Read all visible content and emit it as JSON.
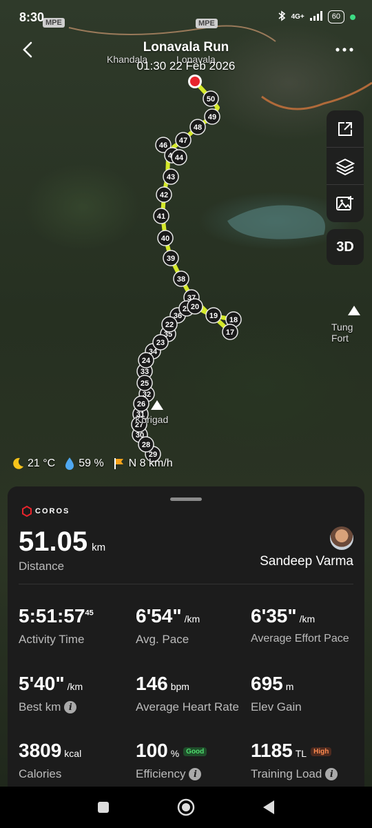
{
  "status_bar": {
    "time": "8:30",
    "network": "4G+",
    "battery": "60"
  },
  "header": {
    "title": "Lonavala Run",
    "subtitle": "01:30 22 Feb 2026"
  },
  "map": {
    "place_labels": [
      "Khandala",
      "Lonavala",
      "Tung Fort",
      "Korigad"
    ],
    "road_labels": [
      "MPE",
      "MPE"
    ],
    "km_markers": [
      "50",
      "49",
      "48",
      "47",
      "46",
      "45",
      "44",
      "43",
      "42",
      "41",
      "40",
      "39",
      "38",
      "37",
      "36",
      "35",
      "34",
      "33",
      "32",
      "31",
      "30",
      "29",
      "28",
      "27",
      "26",
      "25",
      "24",
      "23",
      "22",
      "21",
      "20",
      "19",
      "18",
      "17"
    ],
    "toolbar": [
      "share-icon",
      "layers-icon",
      "add-photo-icon"
    ],
    "three_d_label": "3D"
  },
  "weather": {
    "temperature": "21 °C",
    "humidity": "59 %",
    "wind": "N 8 km/h"
  },
  "panel": {
    "brand": "COROS",
    "distance_value": "51.05",
    "distance_unit": "km",
    "distance_label": "Distance",
    "user_name": "Sandeep Varma",
    "stats": [
      {
        "value": "5:51:57",
        "sup": "45",
        "unit": "",
        "label": "Activity Time"
      },
      {
        "value": "6'54\"",
        "unit": "/km",
        "label": "Avg. Pace"
      },
      {
        "value": "6'35\"",
        "unit": "/km",
        "label": "Average Effort Pace"
      },
      {
        "value": "5'40\"",
        "unit": "/km",
        "label": "Best km"
      },
      {
        "value": "146",
        "unit": "bpm",
        "label": "Average Heart Rate"
      },
      {
        "value": "695",
        "unit": "m",
        "label": "Elev Gain"
      },
      {
        "value": "3809",
        "unit": "kcal",
        "label": "Calories"
      },
      {
        "value": "100",
        "unit": "%",
        "badge": "Good",
        "label": "Efficiency"
      },
      {
        "value": "1185",
        "unit": "TL",
        "badge": "High",
        "label": "Training Load"
      }
    ]
  },
  "colors": {
    "route": "#d4e82a",
    "panel_bg": "#1c1c1c",
    "start_marker": "#e8242c"
  }
}
